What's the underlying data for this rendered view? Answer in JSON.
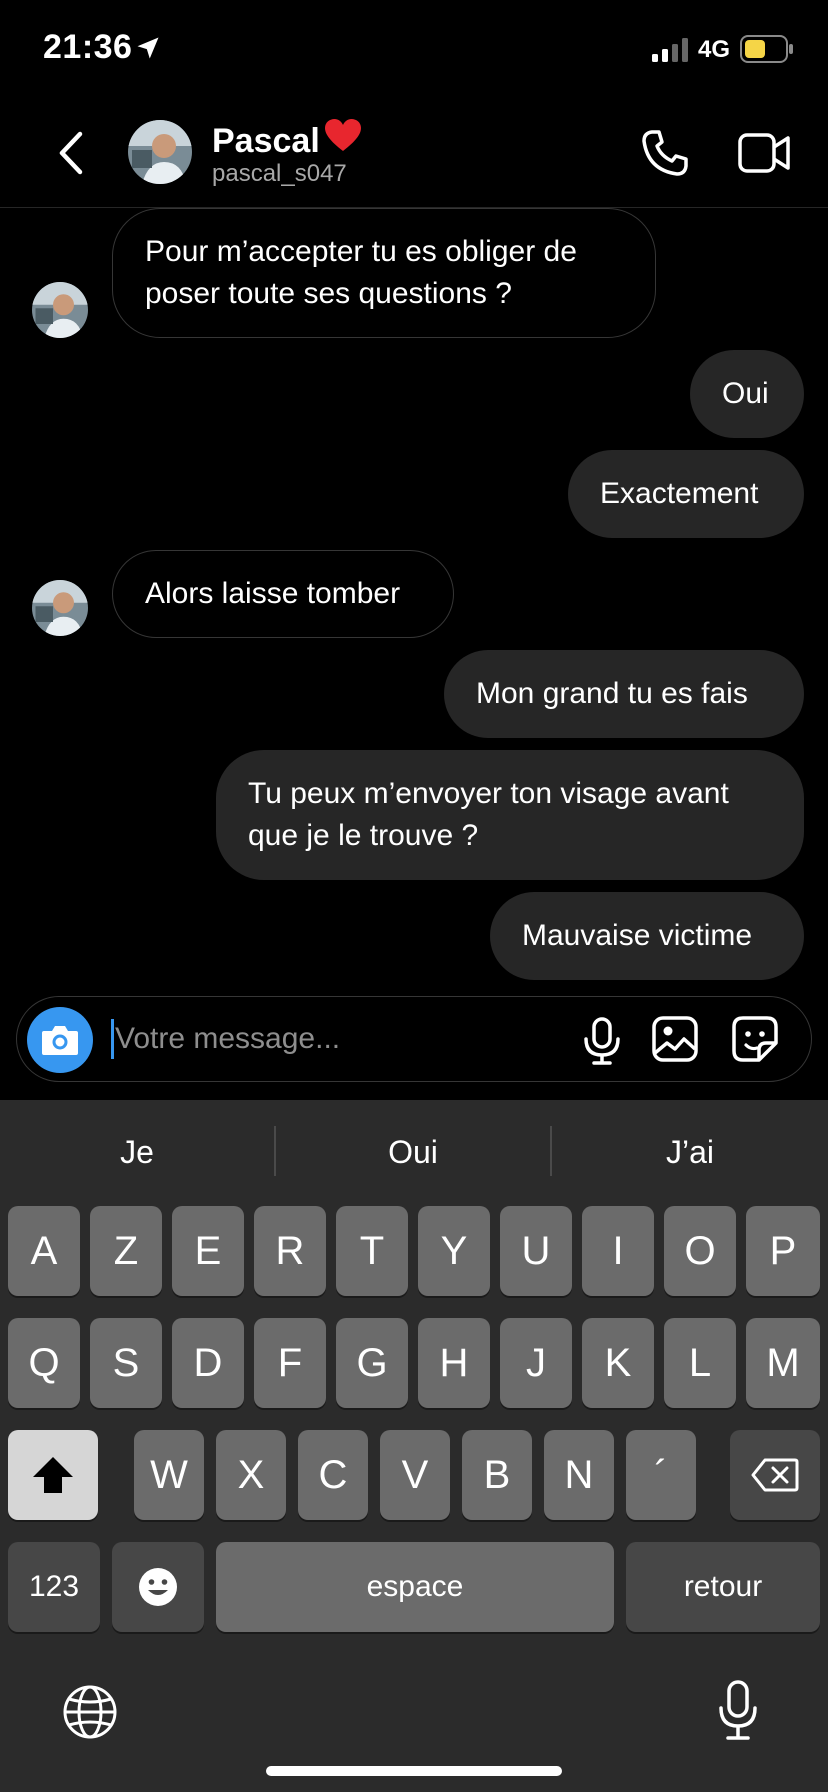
{
  "status_bar": {
    "time": "21:36",
    "network": "4G"
  },
  "header": {
    "name": "Pascal",
    "heart": "❤️",
    "handle": "pascal_s047"
  },
  "messages": [
    {
      "side": "in",
      "lines": [
        "Pour m’accepter tu es obliger de",
        "poser toute ses questions ?"
      ]
    },
    {
      "side": "out",
      "lines": [
        "Oui"
      ]
    },
    {
      "side": "out",
      "lines": [
        "Exactement"
      ]
    },
    {
      "side": "in",
      "lines": [
        "Alors laisse tomber"
      ]
    },
    {
      "side": "out",
      "lines": [
        "Mon grand tu es fais"
      ]
    },
    {
      "side": "out",
      "lines": [
        "Tu peux m’envoyer ton visage avant",
        "que je le trouve ?"
      ]
    },
    {
      "side": "out",
      "lines": [
        "Mauvaise victime"
      ]
    }
  ],
  "composer": {
    "placeholder": "Votre message...",
    "value": ""
  },
  "keyboard": {
    "suggestions": [
      "Je",
      "Oui",
      "J’ai"
    ],
    "row1": [
      "A",
      "Z",
      "E",
      "R",
      "T",
      "Y",
      "U",
      "I",
      "O",
      "P"
    ],
    "row2": [
      "Q",
      "S",
      "D",
      "F",
      "G",
      "H",
      "J",
      "K",
      "L",
      "M"
    ],
    "row3": [
      "W",
      "X",
      "C",
      "V",
      "B",
      "N",
      "´"
    ],
    "numbers_label": "123",
    "space_label": "espace",
    "return_label": "retour"
  },
  "colors": {
    "accent": "#3797f0",
    "bubble_out": "#262626",
    "keyboard_bg": "#2b2b2b",
    "key": "#6b6b6b"
  }
}
